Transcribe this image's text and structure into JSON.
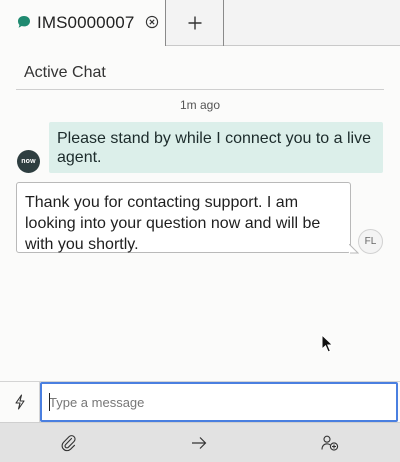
{
  "tab": {
    "title": "IMS0000007",
    "chat_icon": "chat-bubble-icon",
    "close_icon": "close-circle-icon"
  },
  "add_tab_icon": "plus-icon",
  "header": {
    "title": "Active Chat"
  },
  "timestamp": "1m ago",
  "messages": [
    {
      "side": "right",
      "text": "Please stand by while I connect you to a live agent."
    },
    {
      "side": "left",
      "text": "Thank you for contacting support. I am looking into your question now and will be with you shortly."
    }
  ],
  "avatars": {
    "agent_logo": "now",
    "user_initials": "FL"
  },
  "composer": {
    "placeholder": "Type a message",
    "value": "",
    "quick_icon": "lightning-icon"
  },
  "footer": {
    "attach_icon": "paperclip-icon",
    "send_icon": "arrow-right-icon",
    "add_user_icon": "add-user-icon"
  },
  "colors": {
    "accent": "#4a7fe0",
    "bubble_right": "#dcefea",
    "brand_green": "#1f8a70",
    "agent_avatar": "#2e3e40"
  }
}
